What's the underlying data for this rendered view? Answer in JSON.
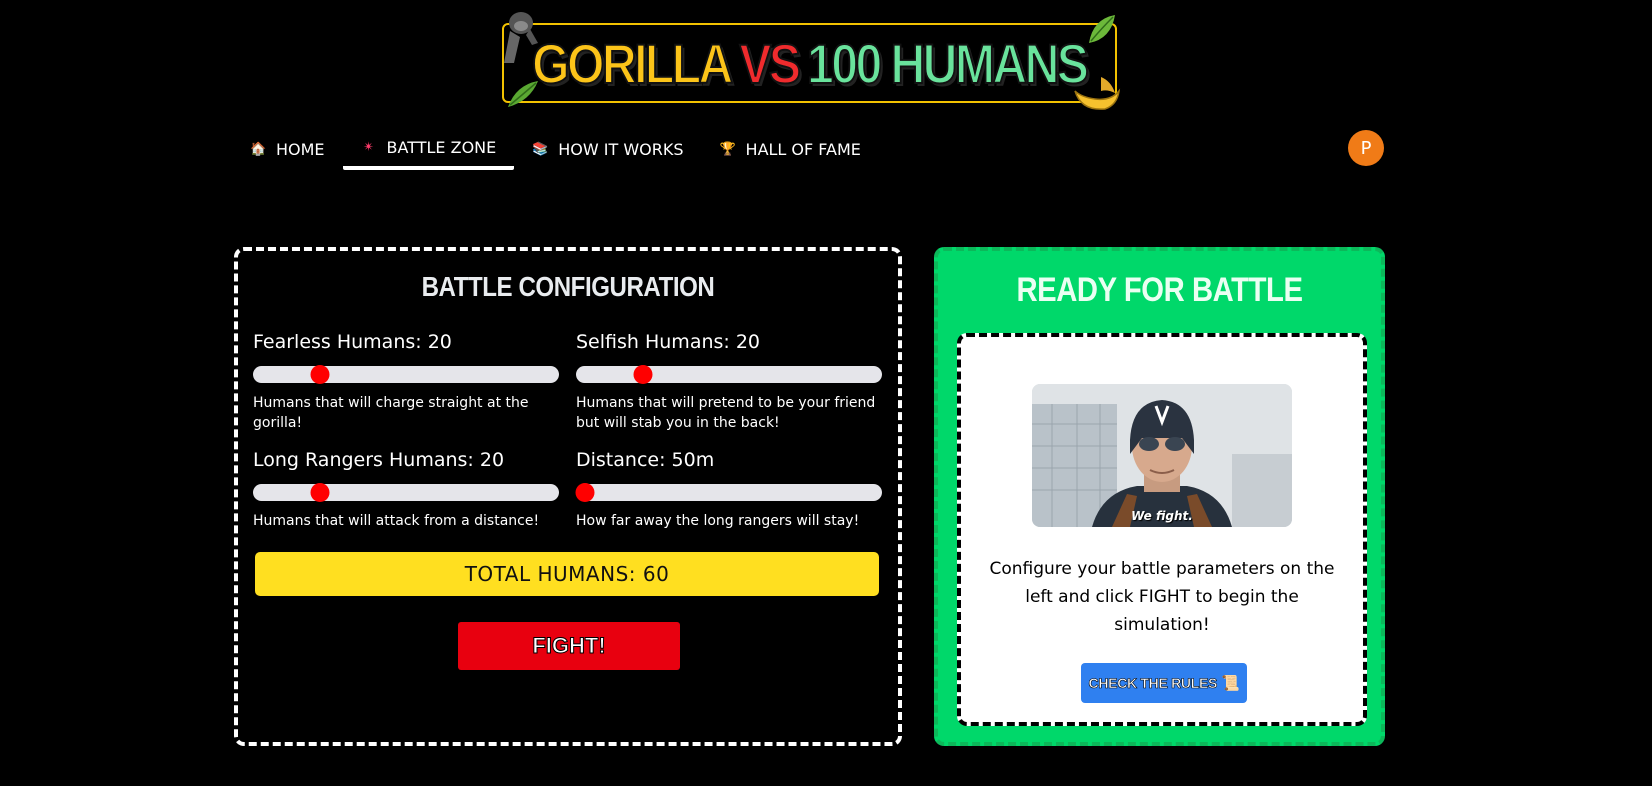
{
  "logo": {
    "part1": "GORILLA",
    "part2": "VS",
    "part3": "100 HUMANS"
  },
  "nav": {
    "items": [
      {
        "label": "HOME",
        "icon": "house-icon",
        "glyph": "🏠"
      },
      {
        "label": "BATTLE ZONE",
        "icon": "sparkle-icon",
        "glyph": "✴"
      },
      {
        "label": "HOW IT WORKS",
        "icon": "books-icon",
        "glyph": "📚"
      },
      {
        "label": "HALL OF FAME",
        "icon": "trophy-icon",
        "glyph": "🏆"
      }
    ],
    "active": "BATTLE ZONE",
    "avatar_letter": "P"
  },
  "config": {
    "title": "BATTLE CONFIGURATION",
    "sliders": [
      {
        "label": "Fearless Humans: 20",
        "value": 20,
        "description": "Humans that will charge straight at the gorilla!"
      },
      {
        "label": "Selfish Humans: 20",
        "value": 20,
        "description": "Humans that will pretend to be your friend but will stab you in the back!"
      },
      {
        "label": "Long Rangers Humans: 20",
        "value": 20,
        "description": "Humans that will attack from a distance!"
      },
      {
        "label": "Distance: 50m",
        "value": 50,
        "description": "How far away the long rangers will stay!"
      }
    ],
    "total": "TOTAL HUMANS: 60",
    "fight_label": "FIGHT!"
  },
  "ready": {
    "title": "READY FOR BATTLE",
    "gif_caption": "We fight.",
    "message": "Configure your battle parameters on the left and click FIGHT to begin the simulation!",
    "rules_label": "CHECK THE RULES",
    "rules_icon": "scroll-icon"
  },
  "colors": {
    "background": "#000000",
    "logo_yellow": "#fcc419",
    "logo_red": "#ef2b2d",
    "logo_green": "#69e39c",
    "slider_thumb": "#ff0000",
    "total_bar": "#ffdf20",
    "fight_button": "#e8000f",
    "ready_panel": "#00d86a",
    "rules_button": "#2f80f0",
    "avatar": "#f07b17"
  }
}
